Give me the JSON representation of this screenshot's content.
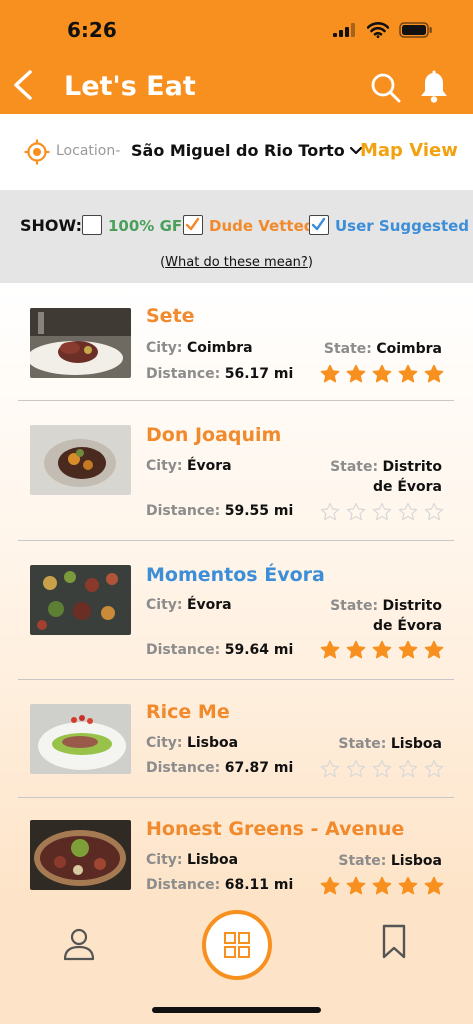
{
  "status_bar": {
    "time": "6:26"
  },
  "header": {
    "title": "Let's Eat"
  },
  "location": {
    "label": "Location-",
    "value": "São Miguel do Rio Torto",
    "map_view_label": "Map View"
  },
  "filters": {
    "show_label": "SHOW:",
    "items": [
      {
        "label": "100% GF",
        "checked": false,
        "color": "#4aa05a"
      },
      {
        "label": "Dude Vetted",
        "checked": true,
        "color": "#f08a2c"
      },
      {
        "label": "User Suggested",
        "checked": true,
        "color": "#3d8ed8"
      }
    ],
    "help_prefix": "(",
    "help_link": "What do these mean?",
    "help_suffix": ")"
  },
  "labels": {
    "city": "City:",
    "state": "State:",
    "distance": "Distance:"
  },
  "restaurants": [
    {
      "name": "Sete",
      "city": "Coimbra",
      "state": "Coimbra",
      "distance": "56.17 mi",
      "rating": 5,
      "name_color": "#f08a2c"
    },
    {
      "name": "Don Joaquim",
      "city": "Évora",
      "state": "Distrito de Évora",
      "distance": "59.55 mi",
      "rating": 0,
      "name_color": "#f08a2c"
    },
    {
      "name": "Momentos Évora",
      "city": "Évora",
      "state": "Distrito de Évora",
      "distance": "59.64 mi",
      "rating": 5,
      "name_color": "#3d8ed8"
    },
    {
      "name": "Rice Me",
      "city": "Lisboa",
      "state": "Lisboa",
      "distance": "67.87 mi",
      "rating": 0,
      "name_color": "#f08a2c"
    },
    {
      "name": "Honest Greens - Avenue",
      "city": "Lisboa",
      "state": "Lisboa",
      "distance": "68.11 mi",
      "rating": 5,
      "name_color": "#f08a2c"
    }
  ],
  "colors": {
    "brand_orange": "#f7901e",
    "star_filled": "#f7901e",
    "star_empty": "#d8d8d8"
  },
  "icons": {
    "back": "chevron-left-icon",
    "search": "search-icon",
    "bell": "bell-icon",
    "location": "crosshair-icon",
    "dropdown": "chevron-down-icon",
    "profile": "person-icon",
    "home": "grid-icon",
    "saved": "bookmark-icon"
  }
}
